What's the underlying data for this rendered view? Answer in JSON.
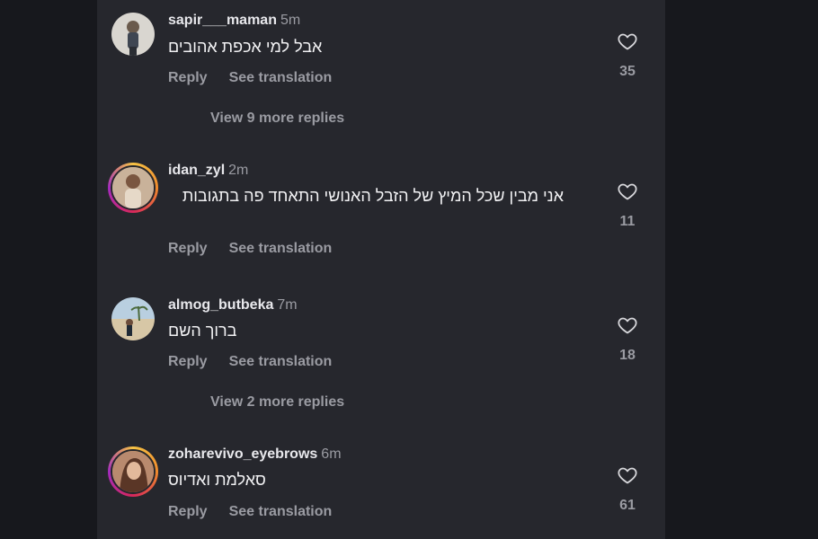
{
  "comments": [
    {
      "username": "sapir___maman",
      "time": "5m",
      "text": "אבל למי אכפת אהובים",
      "reply": "Reply",
      "see_translation": "See translation",
      "likes": "35",
      "view_more": "View 9 more replies"
    },
    {
      "username": "idan_zyl",
      "time": "2m",
      "text": "אני מבין שכל המיץ של הזבל האנושי התאחד פה בתגובות",
      "reply": "Reply",
      "see_translation": "See translation",
      "likes": "11"
    },
    {
      "username": "almog_butbeka",
      "time": "7m",
      "text": "ברוך השם",
      "reply": "Reply",
      "see_translation": "See translation",
      "likes": "18",
      "view_more": "View 2 more replies"
    },
    {
      "username": "zoharevivo_eyebrows",
      "time": "6m",
      "text": "סאלמת ואדיוס",
      "reply": "Reply",
      "see_translation": "See translation",
      "likes": "61"
    }
  ],
  "colors": {
    "background": "#17181d",
    "panel": "#26272d",
    "text": "#f2f2f4",
    "muted": "#9a9ba2"
  }
}
